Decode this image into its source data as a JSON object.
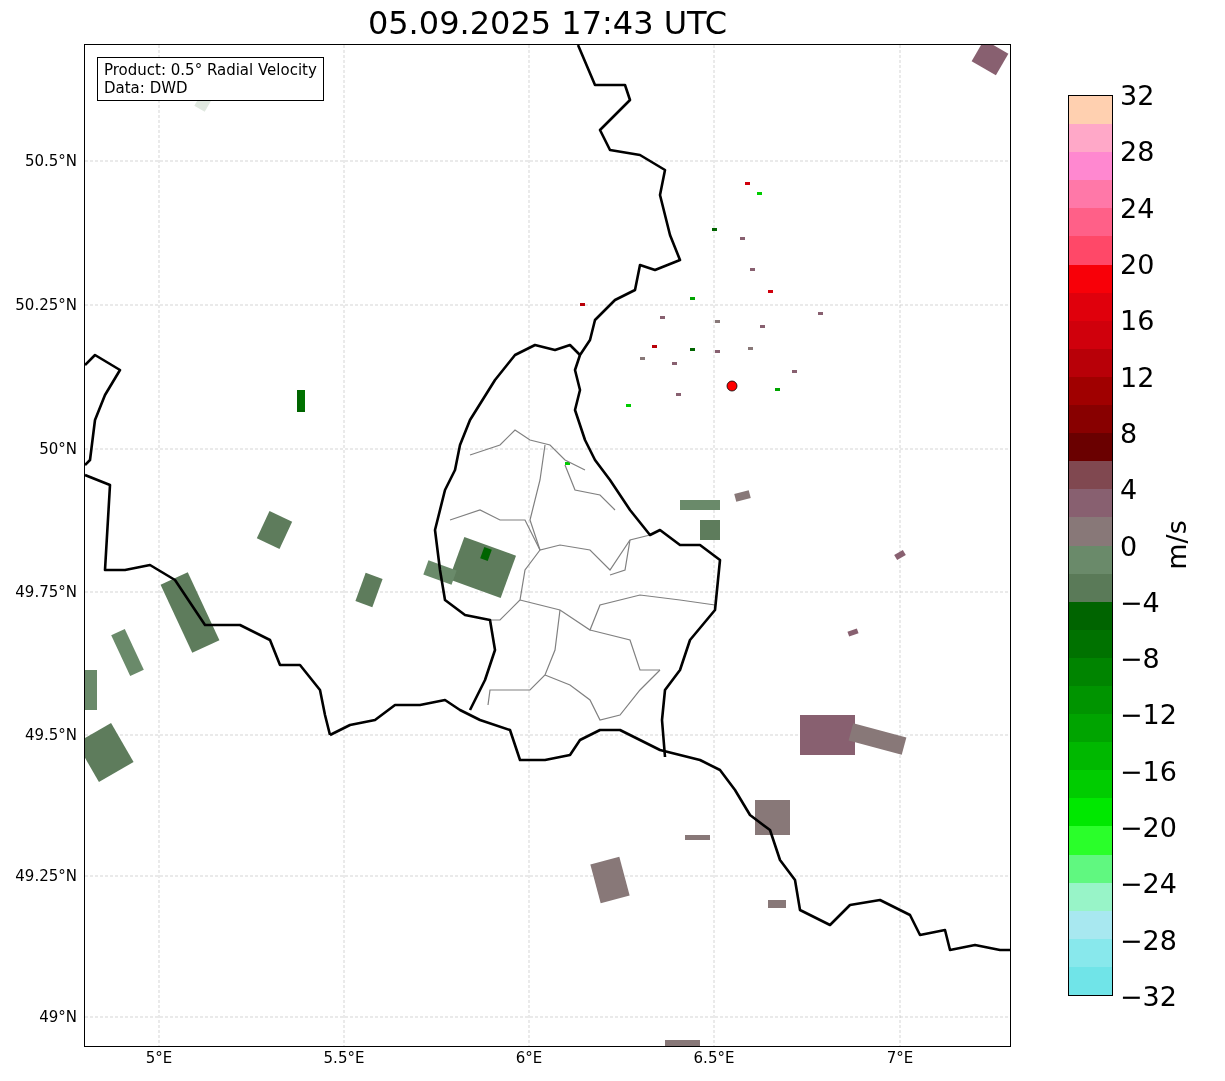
{
  "title": "05.09.2025 17:43 UTC",
  "info_box": [
    "Product: 0.5° Radial Velocity",
    "Data: DWD"
  ],
  "map": {
    "x_ticks": [
      "5°E",
      "5.5°E",
      "6°E",
      "6.5°E",
      "7°E"
    ],
    "y_ticks": [
      "50.5°N",
      "50.25°N",
      "50°N",
      "49.75°N",
      "49.5°N",
      "49.25°N",
      "49°N"
    ]
  },
  "colorbar": {
    "label": "m/s",
    "ticks": [
      "32",
      "28",
      "24",
      "20",
      "16",
      "12",
      "8",
      "4",
      "0",
      "−4",
      "−8",
      "−12",
      "−16",
      "−20",
      "−24",
      "−28",
      "−32"
    ],
    "bands": [
      {
        "color": "#ffd0b0"
      },
      {
        "color": "#ffa8c8"
      },
      {
        "color": "#ff88d0"
      },
      {
        "color": "#ff78a8"
      },
      {
        "color": "#ff6088"
      },
      {
        "color": "#ff4868"
      },
      {
        "color": "#f80008"
      },
      {
        "color": "#e0000c"
      },
      {
        "color": "#d0000c"
      },
      {
        "color": "#b80008"
      },
      {
        "color": "#a00000"
      },
      {
        "color": "#880000"
      },
      {
        "color": "#6a0000"
      },
      {
        "color": "#804850"
      },
      {
        "color": "#886070"
      },
      {
        "color": "#887878"
      },
      {
        "color": "#6a8a6a"
      },
      {
        "color": "#5a7a58"
      },
      {
        "color": "#006400"
      },
      {
        "color": "#007200"
      },
      {
        "color": "#008400"
      },
      {
        "color": "#009400"
      },
      {
        "color": "#00a400"
      },
      {
        "color": "#00b800"
      },
      {
        "color": "#00cc00"
      },
      {
        "color": "#00e800"
      },
      {
        "color": "#2aff2a"
      },
      {
        "color": "#60f880"
      },
      {
        "color": "#98f4c8"
      },
      {
        "color": "#a8e8f0"
      },
      {
        "color": "#88e8ec"
      },
      {
        "color": "#70e4e8"
      }
    ]
  }
}
